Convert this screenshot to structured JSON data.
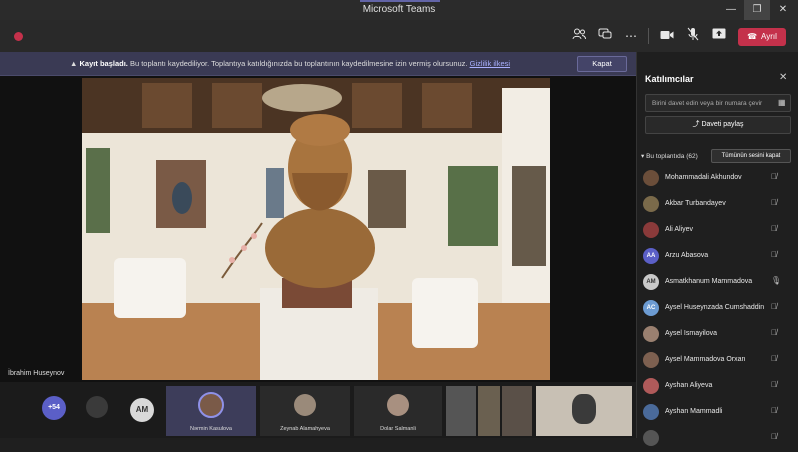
{
  "window": {
    "title": "Microsoft Teams",
    "minimize": "—",
    "restore": "❐",
    "close": "✕"
  },
  "toolbar": {
    "timer": "",
    "icons": {
      "participants": "participants-icon",
      "chat": "chat-icon",
      "more": "more-icon",
      "camera": "camera-icon",
      "mic": "mic-off-icon",
      "share": "share-tray-icon"
    },
    "leave_label": "Ayrıl",
    "leave_color": "#c4314b"
  },
  "banner": {
    "bold": "Kayıt başladı.",
    "text": " Bu toplantı kaydediliyor. Toplantıya katıldığınızda bu toplantının kaydedilmesine izin vermiş olursunuz. ",
    "link": "Gizlilik ilkesi",
    "dismiss": "Kapat"
  },
  "stage": {
    "speaker_name": "İbrahim Huseynov"
  },
  "strip": {
    "overflow": "+54",
    "tiles": [
      {
        "initials": "AM",
        "name": ""
      },
      {
        "name": "Nərmin Kasulova"
      },
      {
        "name": "Zeynab Alamahyeva"
      },
      {
        "name": "Dolar Salmanli"
      }
    ]
  },
  "panel": {
    "title": "Katılımcılar",
    "invite_placeholder": "Birini davet edin veya bir numara çevir",
    "share_invite": "Daveti paylaş",
    "section": "Bu toplantıda (62)",
    "mute_all": "Tümünün sesini kapat",
    "participants": [
      {
        "name": "Mohammadali Akhundov",
        "initials": "",
        "color": "#6b4e3a"
      },
      {
        "name": "Akbar Turbandayev",
        "initials": "",
        "color": "#7a6a4a"
      },
      {
        "name": "Ali Aliyev",
        "initials": "",
        "color": "#8a3a3a"
      },
      {
        "name": "Arzu Abasova",
        "initials": "AA",
        "color": "#5b5fc7"
      },
      {
        "name": "Asmatkhanum Mammadova",
        "initials": "AM",
        "color": "#c9c9c9"
      },
      {
        "name": "Aysel Huseynzada Cumshaddin",
        "initials": "AC",
        "color": "#6c9bd2"
      },
      {
        "name": "Aysel Ismayilova",
        "initials": "",
        "color": "#9a8070"
      },
      {
        "name": "Aysel Mammadova Orxan",
        "initials": "",
        "color": "#7d6050"
      },
      {
        "name": "Ayshan Aliyeva",
        "initials": "",
        "color": "#b05a5a"
      },
      {
        "name": "Ayshan Mammadli",
        "initials": "",
        "color": "#4a6a9a"
      },
      {
        "name": "",
        "initials": "",
        "color": "#555"
      }
    ]
  }
}
